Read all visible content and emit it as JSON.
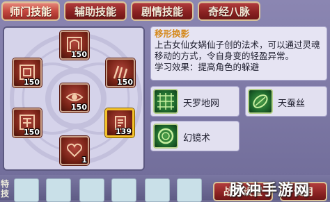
{
  "tabs": [
    {
      "label": "师门技能",
      "active": true
    },
    {
      "label": "辅助技能",
      "active": false
    },
    {
      "label": "剧情技能",
      "active": false
    },
    {
      "label": "奇经八脉",
      "active": false
    }
  ],
  "skills": [
    {
      "level": "150",
      "icon": "gate-icon"
    },
    {
      "level": "150",
      "icon": "frame-icon"
    },
    {
      "level": "150",
      "icon": "claw-icon"
    },
    {
      "level": "150",
      "icon": "eye-icon"
    },
    {
      "level": "150",
      "icon": "seal-icon"
    },
    {
      "level": "139",
      "icon": "scroll-icon",
      "selected": true
    },
    {
      "level": "1",
      "icon": "heart-icon"
    }
  ],
  "info": {
    "title": "移形换影",
    "description": "上古女仙女娲仙子创的法术，可以通过灵魂移动的方式，令自身变的轻盈异常。",
    "effect": "学习效果：提高角色的躲避"
  },
  "sub_skills": [
    {
      "name": "天罗地网",
      "icon": "net-icon"
    },
    {
      "name": "天蚕丝",
      "icon": "cocoon-icon"
    },
    {
      "name": "幻镜术",
      "icon": "mirror-icon"
    }
  ],
  "bottom": {
    "special_label": "特技",
    "buttons": [
      "战斗设置",
      "使用"
    ]
  },
  "watermark": "脉冲手游网",
  "colors": {
    "tab_red": "#8b2222",
    "panel_purple": "#6f6b98",
    "info_title": "#d58a1e",
    "selected_border": "#f4c22b"
  }
}
